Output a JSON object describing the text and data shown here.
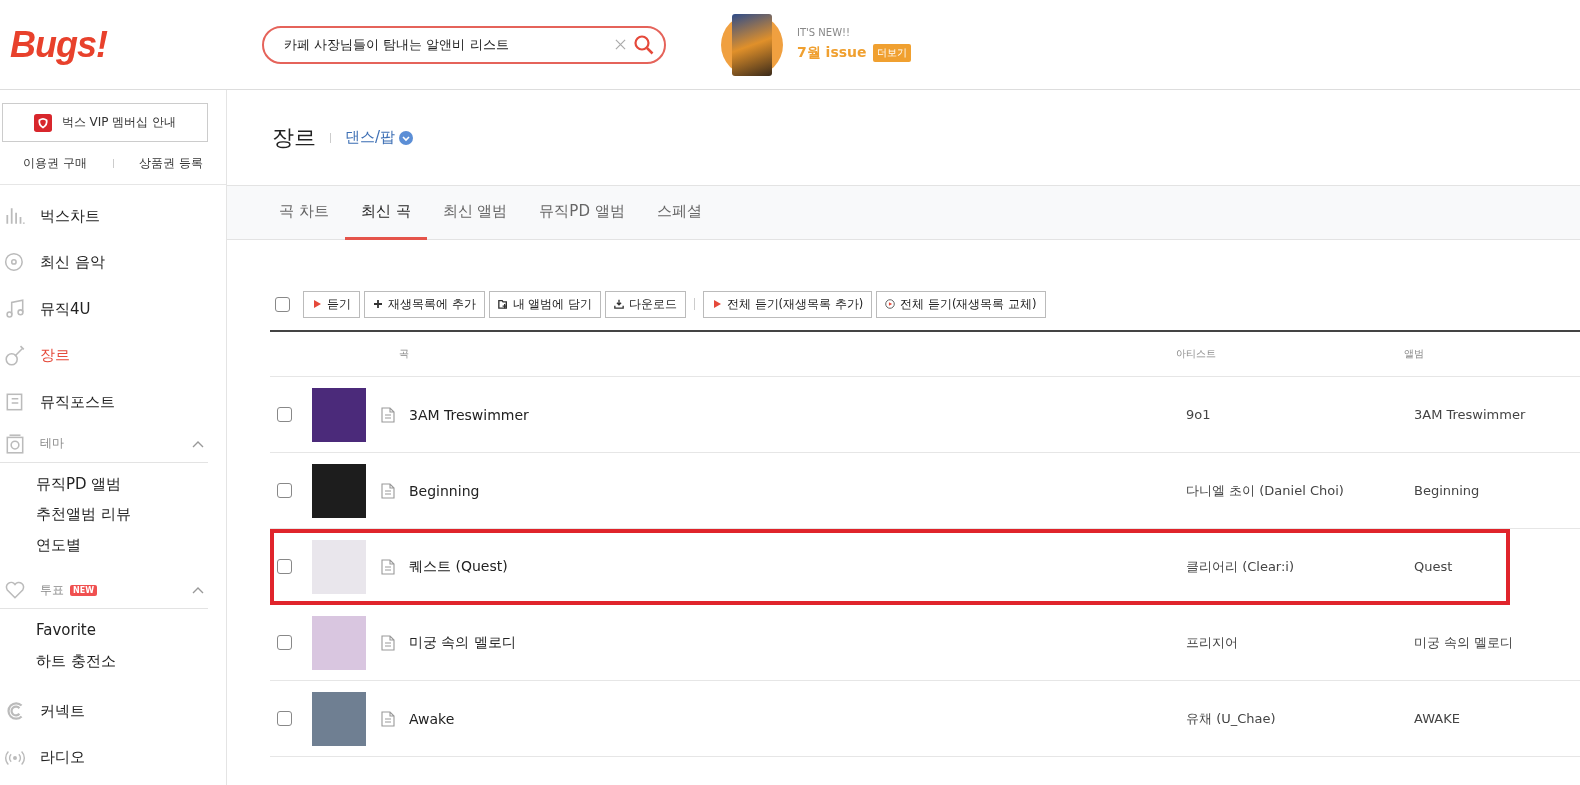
{
  "header": {
    "logo": "Bugs!",
    "search": {
      "value": "카페 사장님들이 탐내는 알앤비 리스트"
    },
    "promo": {
      "eyebrow": "IT'S NEW!!",
      "title": "7월 issue",
      "more": "더보기"
    }
  },
  "sidebar": {
    "vip": "벅스 VIP 멤버십 안내",
    "links": [
      "이용권 구매",
      "상품권 등록"
    ],
    "items": [
      {
        "label": "벅스차트",
        "selected": false
      },
      {
        "label": "최신 음악",
        "selected": false
      },
      {
        "label": "뮤직4U",
        "selected": false
      },
      {
        "label": "장르",
        "selected": true
      },
      {
        "label": "뮤직포스트",
        "selected": false
      }
    ],
    "sections": [
      {
        "label": "테마",
        "expanded": true,
        "children": [
          "뮤직PD 앨범",
          "추천앨범 리뷰",
          "연도별"
        ]
      },
      {
        "label": "투표",
        "badge": "NEW",
        "expanded": true,
        "children": [
          "Favorite",
          "하트 충전소"
        ]
      }
    ],
    "bottom_items": [
      {
        "label": "커넥트"
      },
      {
        "label": "라디오"
      }
    ]
  },
  "page": {
    "title": "장르",
    "genre": "댄스/팝"
  },
  "tabs": [
    {
      "label": "곡 차트",
      "selected": false
    },
    {
      "label": "최신 곡",
      "selected": true
    },
    {
      "label": "최신 앨범",
      "selected": false
    },
    {
      "label": "뮤직PD 앨범",
      "selected": false
    },
    {
      "label": "스페셜",
      "selected": false
    }
  ],
  "toolbar": {
    "select_all": {
      "checked": false
    },
    "buttons": [
      {
        "kind": "play",
        "label": "듣기"
      },
      {
        "kind": "add",
        "label": "재생목록에 추가"
      },
      {
        "kind": "album",
        "label": "내 앨범에 담기"
      },
      {
        "kind": "download",
        "label": "다운로드"
      },
      {
        "kind": "play",
        "label": "전체 듣기(재생목록 추가)"
      },
      {
        "kind": "replace",
        "label": "전체 듣기(재생목록 교체)"
      }
    ]
  },
  "table": {
    "columns": [
      "곡",
      "아티스트",
      "앨범"
    ],
    "rows": [
      {
        "title": "3AM Treswimmer",
        "artist": "9o1",
        "album": "3AM Treswimmer",
        "checked": false,
        "highlighted": false
      },
      {
        "title": "Beginning",
        "artist": "다니엘 초이 (Daniel Choi)",
        "album": "Beginning",
        "checked": false,
        "highlighted": false
      },
      {
        "title": "퀘스트 (Quest)",
        "artist": "클리어리 (Clear:i)",
        "album": "Quest",
        "checked": false,
        "highlighted": true
      },
      {
        "title": "미궁 속의 멜로디",
        "artist": "프리지어",
        "album": "미궁 속의 멜로디",
        "checked": false,
        "highlighted": false
      },
      {
        "title": "Awake",
        "artist": "유채 (U_Chae)",
        "album": "AWAKE",
        "checked": false,
        "highlighted": false
      }
    ]
  }
}
